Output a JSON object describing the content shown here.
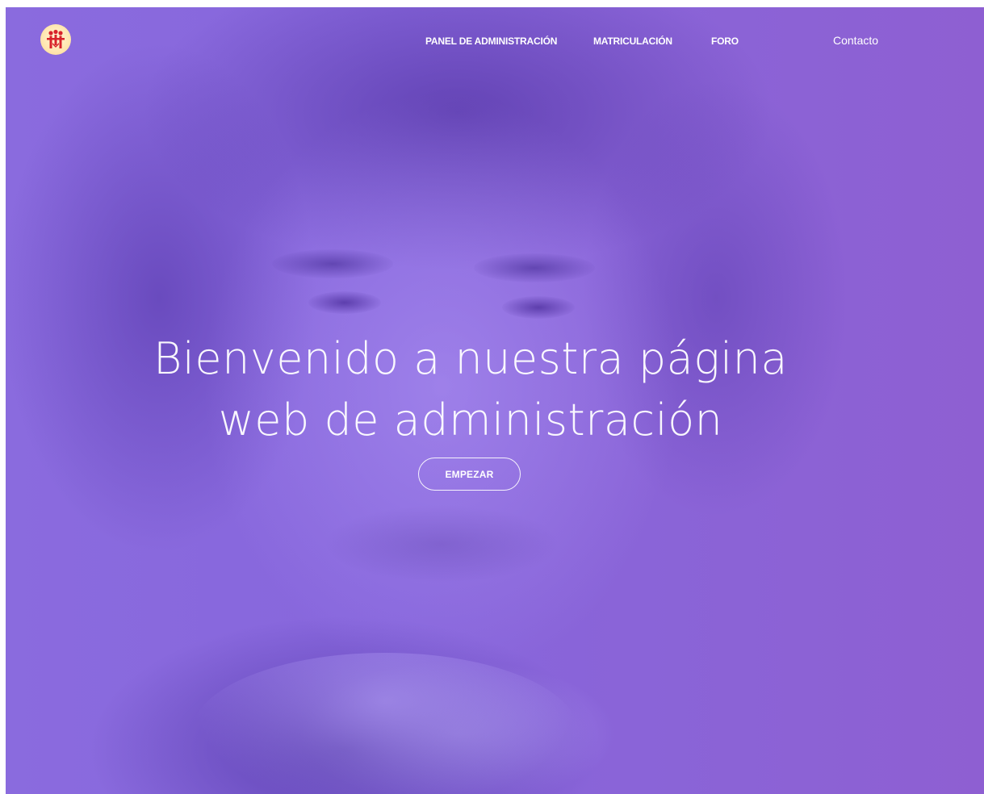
{
  "nav": {
    "logo_name": "salesian-family-logo",
    "links": [
      {
        "label": "PANEL DE ADMINISTRACIÓN"
      },
      {
        "label": "MATRICULACIÓN"
      },
      {
        "label": "FORO"
      }
    ],
    "contact_label": "Contacto"
  },
  "hero": {
    "title_line1": "Bienvenido a nuestra página",
    "title_line2": "web de administración",
    "cta_label": "EMPEZAR"
  },
  "colors": {
    "overlay": "#8a6bde",
    "logo_red": "#d8232a",
    "text": "#ffffff"
  }
}
